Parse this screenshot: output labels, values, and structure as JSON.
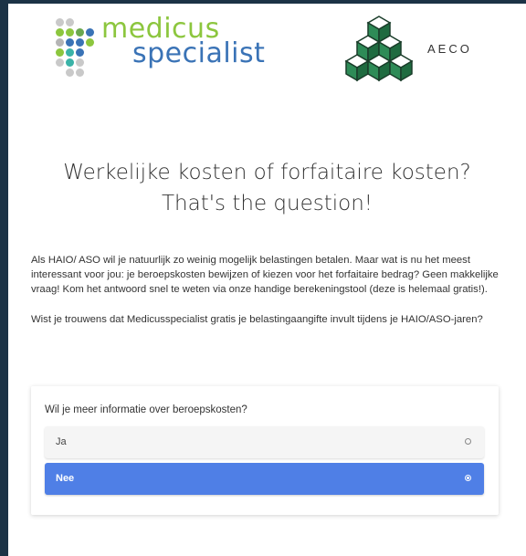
{
  "logos": {
    "medicus_line1": "medicus",
    "medicus_line2": "specialist",
    "aeco_text": "AECO"
  },
  "headline": {
    "line1": "Werkelijke kosten of forfaitaire kosten?",
    "line2": "That's the question!"
  },
  "body": {
    "paragraph1": "Als HAIO/ ASO wil je natuurlijk zo weinig mogelijk belastingen betalen. Maar wat is nu het meest interessant voor jou:  je beroepskosten bewijzen of kiezen voor het forfaitaire bedrag? Geen makkelijke vraag! Kom het antwoord snel te weten via  onze handige berekeningstool (deze is helemaal gratis!).",
    "paragraph2": "Wist je trouwens dat Medicusspecialist gratis je belastingaangifte invult tijdens je HAIO/ASO-jaren?"
  },
  "survey": {
    "question": "Wil je meer informatie over beroepskosten?",
    "options": [
      {
        "label": "Ja",
        "selected": false
      },
      {
        "label": "Nee",
        "selected": true
      }
    ]
  },
  "colors": {
    "background_frame": "#1c3346",
    "medicus_green": "#8cc63e",
    "medicus_blue": "#3a73b6",
    "aeco_green": "#2e8b57",
    "selected_option": "#4f7fe6"
  }
}
